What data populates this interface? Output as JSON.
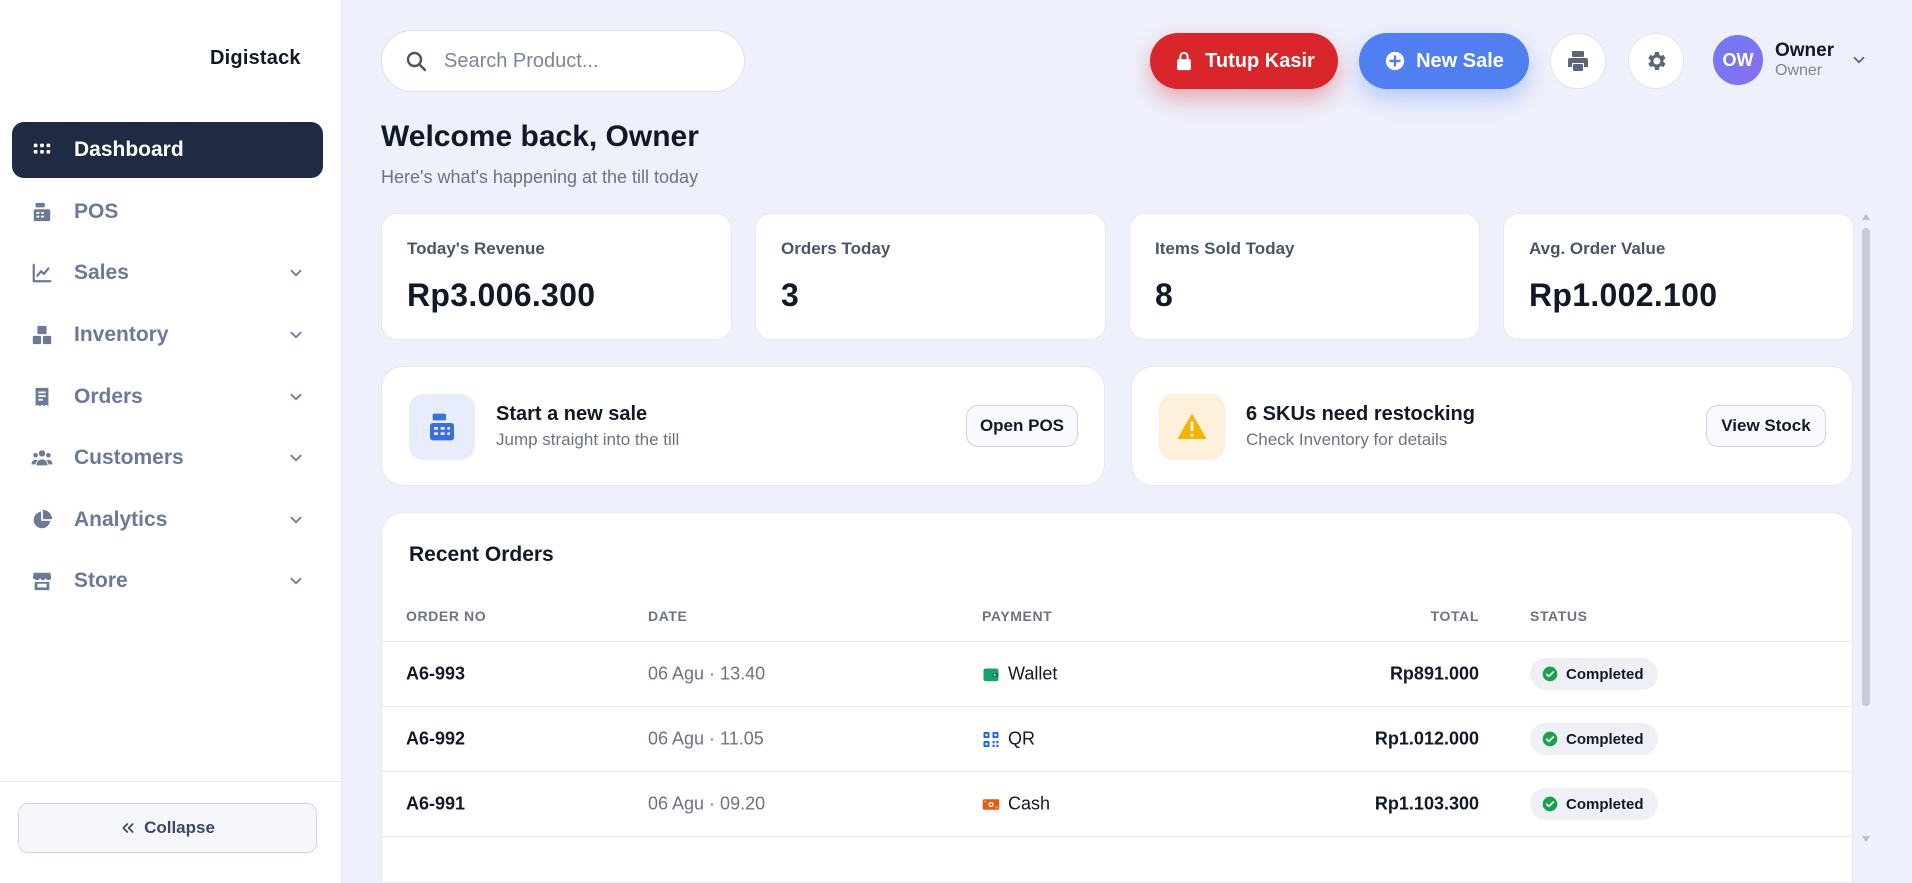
{
  "brand": "Digistack",
  "sidebar": {
    "items": [
      {
        "label": "Dashboard",
        "icon": "grid-icon",
        "active": true
      },
      {
        "label": "POS",
        "icon": "cash-register-icon"
      },
      {
        "label": "Sales",
        "icon": "chart-line-icon"
      },
      {
        "label": "Inventory",
        "icon": "boxes-icon"
      },
      {
        "label": "Orders",
        "icon": "receipt-icon"
      },
      {
        "label": "Customers",
        "icon": "users-icon"
      },
      {
        "label": "Analytics",
        "icon": "pie-chart-icon"
      },
      {
        "label": "Store",
        "icon": "store-icon"
      }
    ],
    "collapse_label": "Collapse"
  },
  "header": {
    "search_placeholder": "Search Product...",
    "close_register_label": "Tutup Kasir",
    "new_sale_label": "New Sale",
    "user": {
      "initials": "OW",
      "name": "Owner",
      "role": "Owner"
    }
  },
  "welcome": {
    "title": "Welcome back, Owner",
    "subtitle": "Here's what's happening at the till today"
  },
  "stats": [
    {
      "label": "Today's Revenue",
      "value": "Rp3.006.300"
    },
    {
      "label": "Orders Today",
      "value": "3"
    },
    {
      "label": "Items Sold Today",
      "value": "8"
    },
    {
      "label": "Avg. Order Value",
      "value": "Rp1.002.100"
    }
  ],
  "actions": {
    "new_sale": {
      "title": "Start a new sale",
      "subtitle": "Jump straight into the till",
      "button": "Open POS"
    },
    "restock": {
      "title": "6 SKUs need restocking",
      "subtitle": "Check Inventory for details",
      "button": "View Stock"
    }
  },
  "recent_orders": {
    "title": "Recent Orders",
    "columns": [
      "ORDER NO",
      "DATE",
      "PAYMENT",
      "TOTAL",
      "STATUS"
    ],
    "rows": [
      {
        "order_no": "A6-993",
        "date": "06 Agu · 13.40",
        "payment": "Wallet",
        "payment_icon": "wallet-icon",
        "total": "Rp891.000",
        "status": "Completed"
      },
      {
        "order_no": "A6-992",
        "date": "06 Agu · 11.05",
        "payment": "QR",
        "payment_icon": "qr-icon",
        "total": "Rp1.012.000",
        "status": "Completed"
      },
      {
        "order_no": "A6-991",
        "date": "06 Agu · 09.20",
        "payment": "Cash",
        "payment_icon": "cash-icon",
        "total": "Rp1.103.300",
        "status": "Completed"
      }
    ]
  },
  "colors": {
    "sidebar_active": "#1f2a44",
    "danger": "#d8262b",
    "primary": "#4f7ff0",
    "success": "#16a34a",
    "warning": "#f5b400",
    "background": "#eef0fb"
  }
}
